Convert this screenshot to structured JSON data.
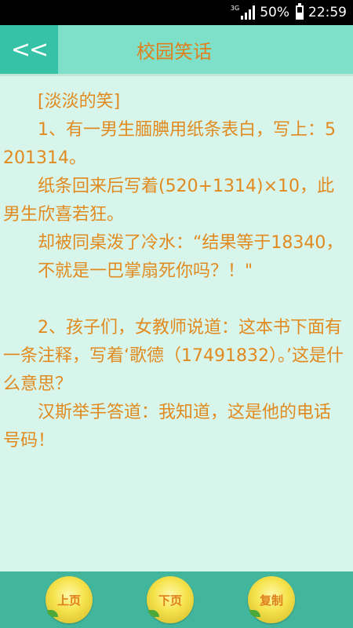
{
  "status_bar": {
    "network": "3G",
    "battery": "50%",
    "time": "22:59"
  },
  "header": {
    "back_label": "<<",
    "title": "校园笑话"
  },
  "content": {
    "lines": [
      "[淡淡的笑]",
      "1、有一男生腼腆用纸条表白，写上：5201314。",
      "纸条回来后写着(520+1314)×10，此男生欣喜若狂。",
      "却被同桌泼了冷水：“结果等于18340，",
      "不就是一巴掌扇死你吗？！\"",
      "",
      "2、孩子们，女教师说道：这本书下面有一条注释，写着‘歌德（17491832）。’这是什么意思？",
      "汉斯举手答道：我知道，这是他的电话号码！"
    ]
  },
  "bottom_bar": {
    "prev_label": "上页",
    "next_label": "下页",
    "copy_label": "复制"
  }
}
